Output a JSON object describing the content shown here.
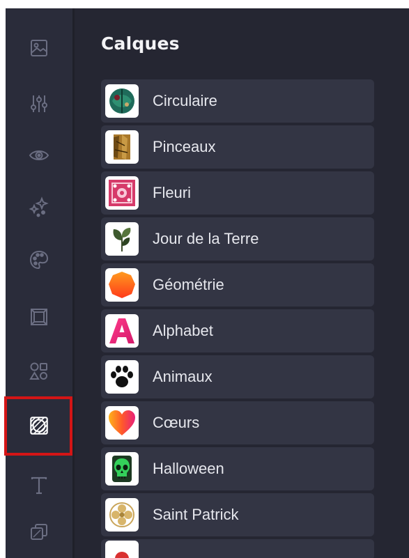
{
  "panel": {
    "title": "Calques",
    "items": [
      {
        "label": "Circulaire",
        "icon": "circular-leaf-icon"
      },
      {
        "label": "Pinceaux",
        "icon": "brush-stroke-icon"
      },
      {
        "label": "Fleuri",
        "icon": "floral-pattern-icon"
      },
      {
        "label": "Jour de la Terre",
        "icon": "leaves-icon"
      },
      {
        "label": "Géométrie",
        "icon": "polygon-icon"
      },
      {
        "label": "Alphabet",
        "icon": "letter-a-icon"
      },
      {
        "label": "Animaux",
        "icon": "paw-print-icon"
      },
      {
        "label": "Cœurs",
        "icon": "heart-icon"
      },
      {
        "label": "Halloween",
        "icon": "skull-icon"
      },
      {
        "label": "Saint Patrick",
        "icon": "clover-ornament-icon"
      }
    ]
  },
  "sidebar": {
    "tools": [
      {
        "icon": "image-icon"
      },
      {
        "icon": "adjustments-sliders-icon"
      },
      {
        "icon": "eye-icon"
      },
      {
        "icon": "sparkles-icon"
      },
      {
        "icon": "palette-icon"
      },
      {
        "icon": "frame-icon"
      },
      {
        "icon": "shapes-icon"
      },
      {
        "icon": "overlay-pattern-icon",
        "active": true
      },
      {
        "icon": "text-icon"
      },
      {
        "icon": "layers-icon"
      }
    ]
  },
  "colors": {
    "rail_bg": "#2a2c3a",
    "panel_bg": "#252632",
    "item_bg": "#333544",
    "icon_muted": "#6b6e82",
    "icon_active": "#ffffff",
    "highlight_border": "#d41516"
  }
}
